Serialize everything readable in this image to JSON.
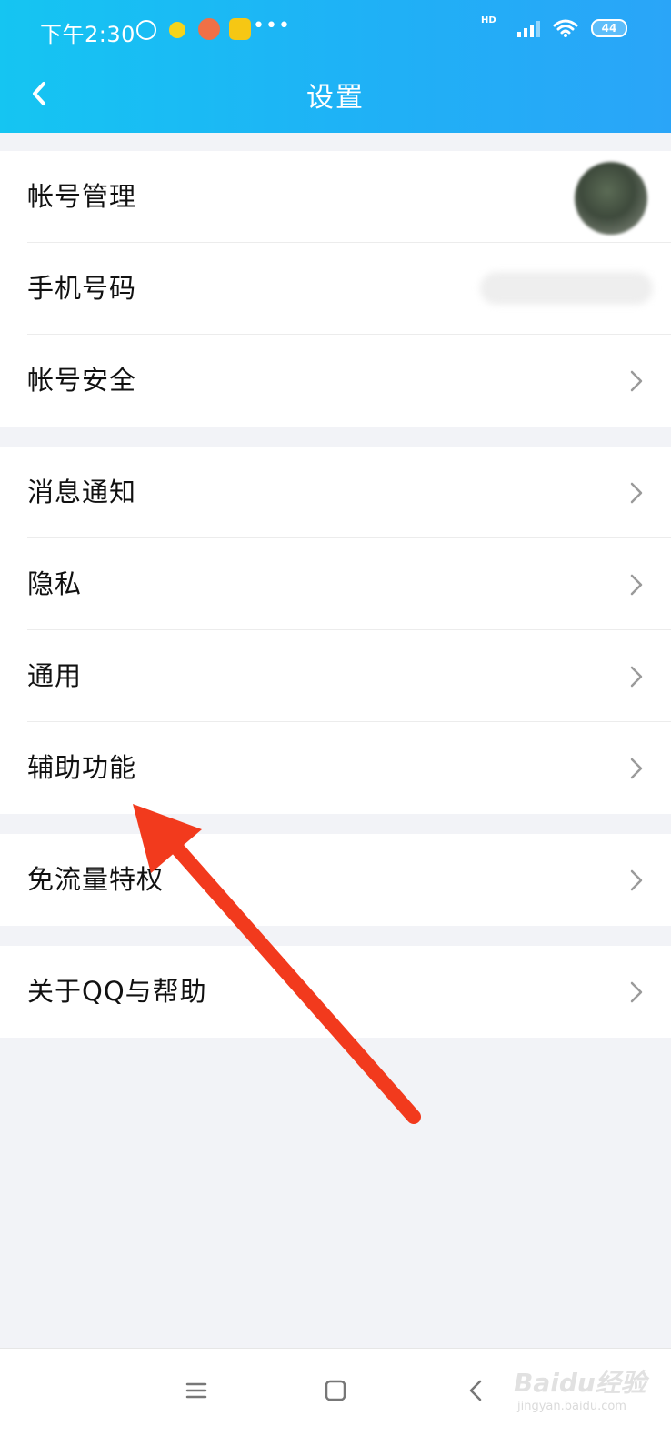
{
  "status_bar": {
    "time": "下午2:30",
    "more": "•••",
    "network": "HD",
    "battery": "44"
  },
  "header": {
    "title": "设置"
  },
  "groups": [
    {
      "items": [
        {
          "label": "帐号管理"
        },
        {
          "label": "手机号码"
        },
        {
          "label": "帐号安全"
        }
      ]
    },
    {
      "items": [
        {
          "label": "消息通知"
        },
        {
          "label": "隐私"
        },
        {
          "label": "通用"
        },
        {
          "label": "辅助功能"
        }
      ]
    },
    {
      "items": [
        {
          "label": "免流量特权"
        }
      ]
    },
    {
      "items": [
        {
          "label": "关于QQ与帮助"
        }
      ]
    }
  ],
  "watermark": {
    "main": "Baidu经验",
    "sub": "jingyan.baidu.com"
  },
  "colors": {
    "header_start": "#15c5f2",
    "header_end": "#2aa5f8",
    "annotation_arrow": "#f23a1d",
    "page_background": "#f2f3f7"
  }
}
